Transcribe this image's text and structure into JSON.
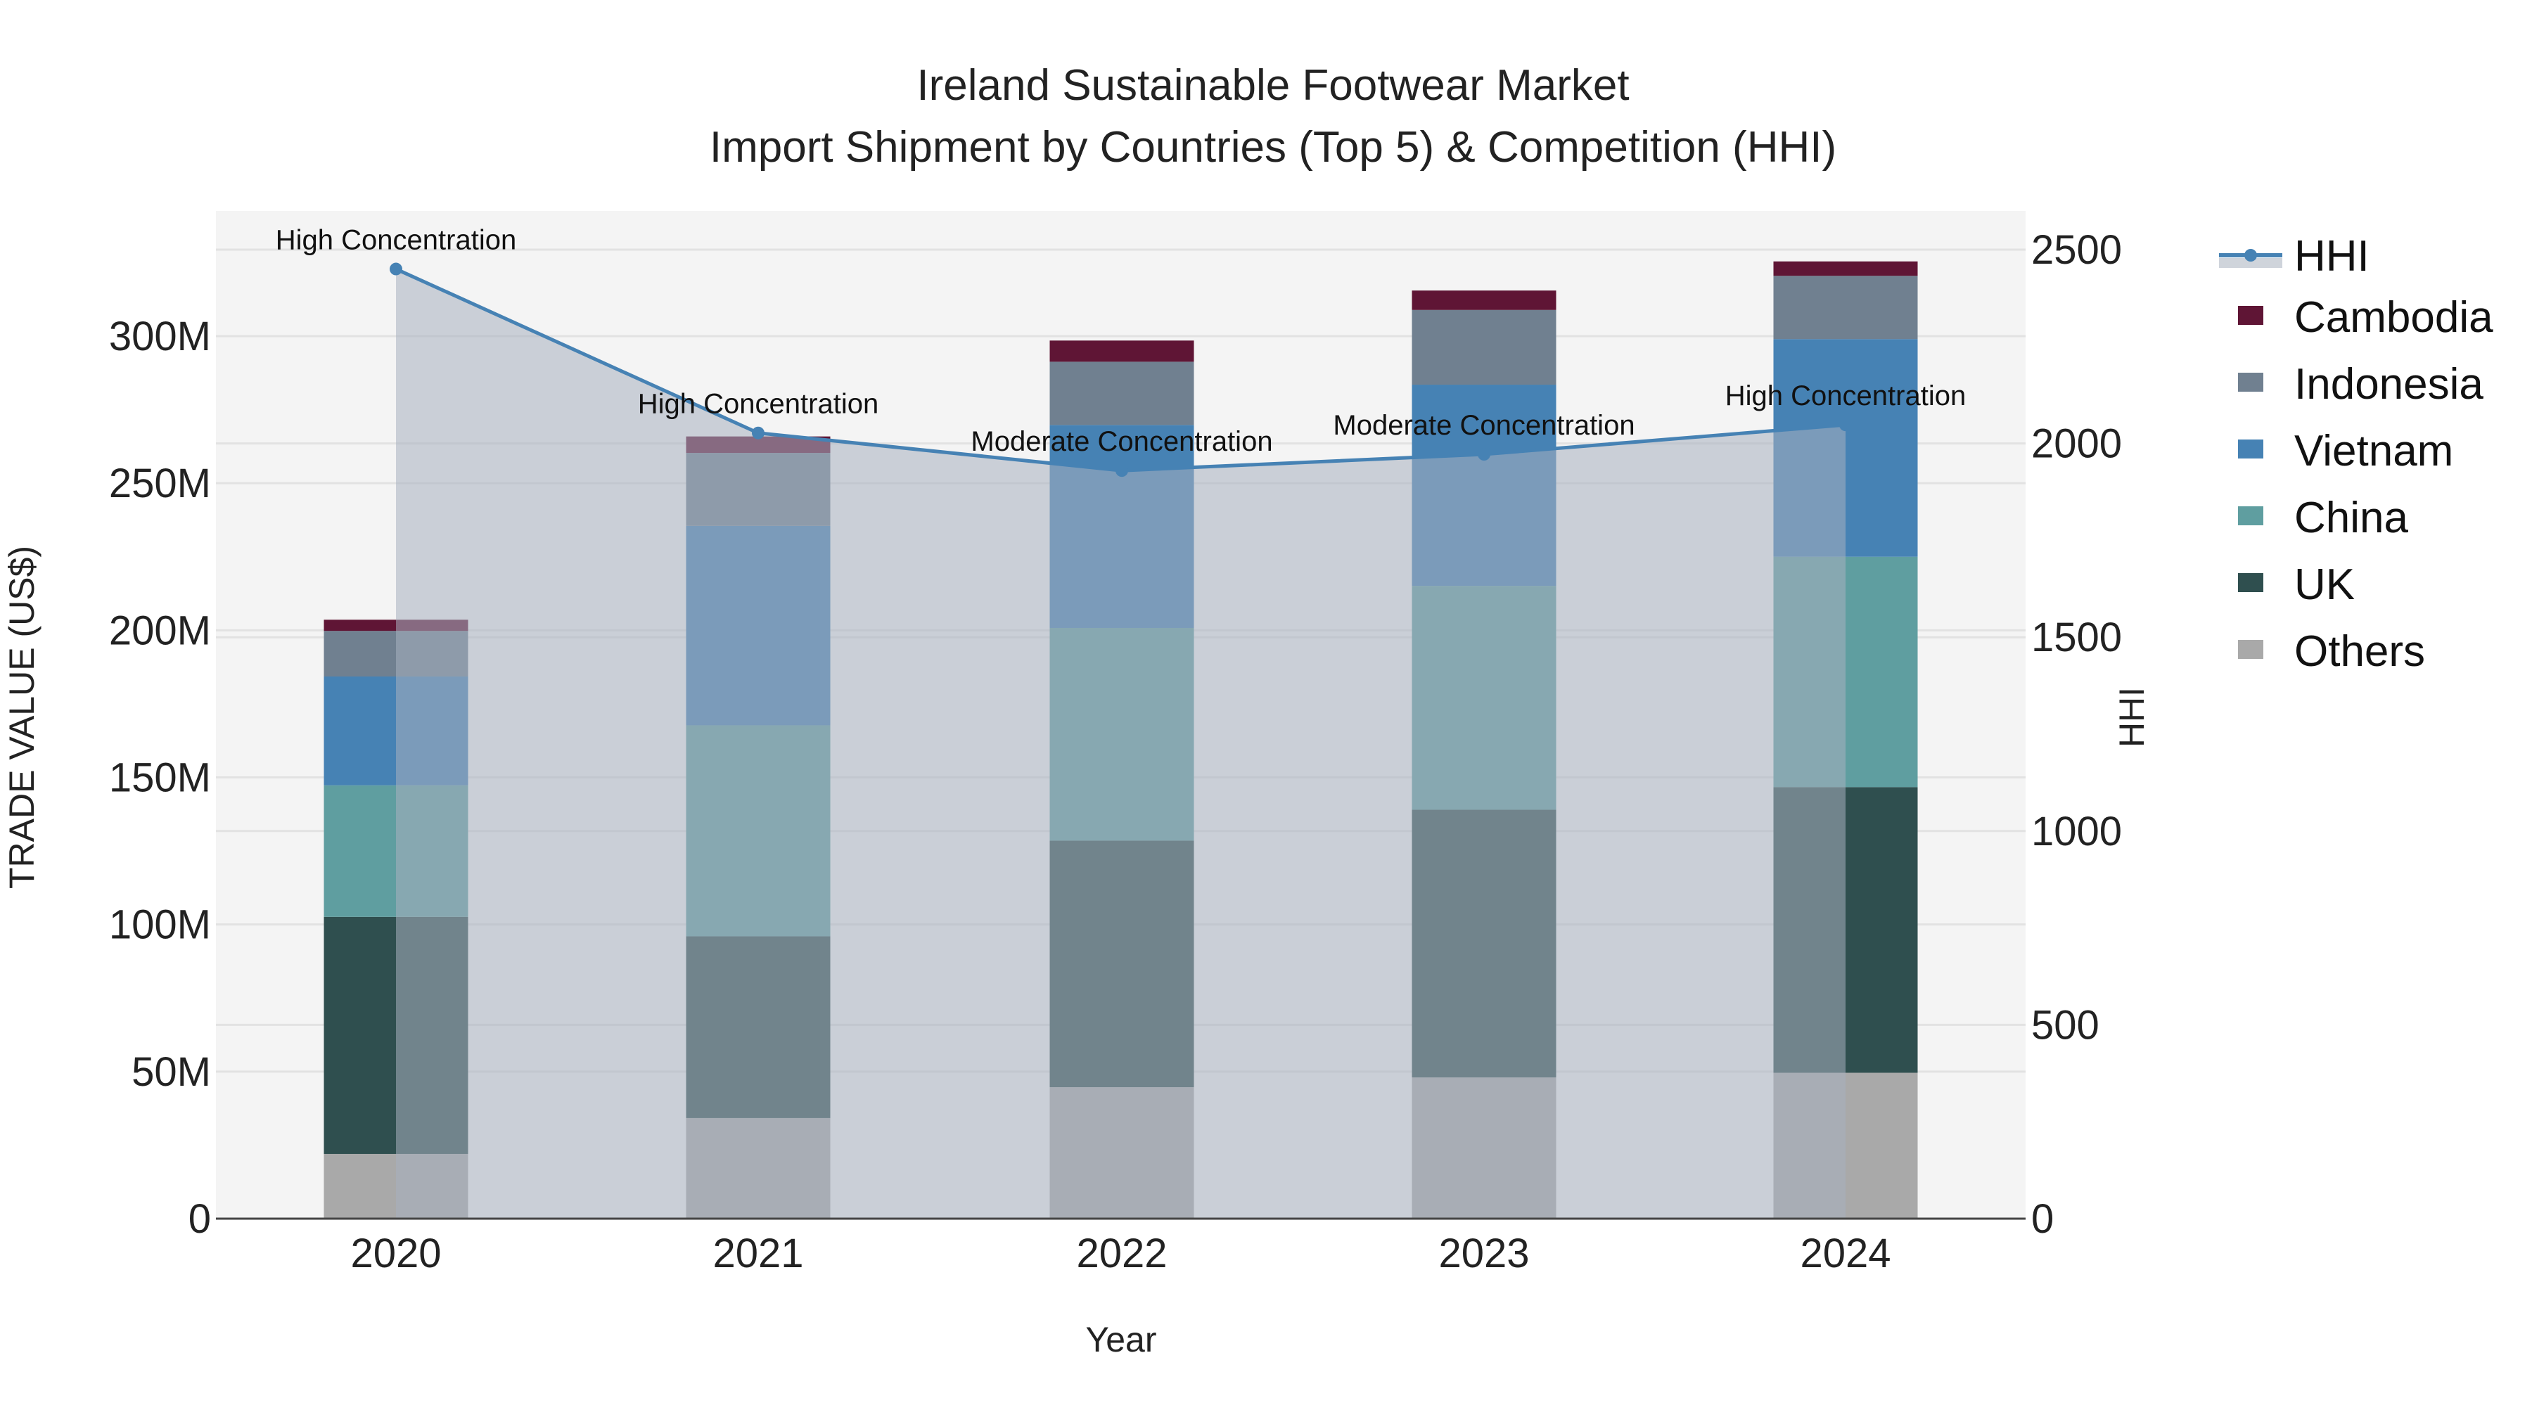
{
  "chart_data": {
    "type": "bar",
    "title_line1": "Ireland Sustainable Footwear Market",
    "title_line2": "Import Shipment by Countries (Top 5) & Competition (HHI)",
    "xlabel": "Year",
    "ylabel": "TRADE VALUE (US$)",
    "y2label": "HHI",
    "categories": [
      "2020",
      "2021",
      "2022",
      "2023",
      "2024"
    ],
    "ylim": [
      0,
      340
    ],
    "y_unit": "M",
    "y_ticks": [
      0,
      50,
      100,
      150,
      200,
      250,
      300
    ],
    "y_tick_labels": [
      "0",
      "50M",
      "100M",
      "150M",
      "200M",
      "250M",
      "300M"
    ],
    "y2lim": [
      0,
      2600
    ],
    "y2_ticks": [
      0,
      500,
      1000,
      1500,
      2000,
      2500
    ],
    "y2_tick_labels": [
      "0",
      "500",
      "1000",
      "1500",
      "2000",
      "2500"
    ],
    "series": [
      {
        "name": "Others",
        "color": "#a9a9a9",
        "values": [
          22.0,
          34.2,
          44.7,
          48.0,
          49.6
        ]
      },
      {
        "name": "UK",
        "color": "#2f4f4f",
        "values": [
          80.6,
          61.8,
          83.8,
          91.0,
          97.1
        ]
      },
      {
        "name": "China",
        "color": "#5f9ea0",
        "values": [
          44.7,
          71.7,
          72.3,
          76.1,
          78.3
        ]
      },
      {
        "name": "Vietnam",
        "color": "#4682b4",
        "values": [
          37.0,
          67.8,
          69.0,
          68.4,
          74.0
        ]
      },
      {
        "name": "Indonesia",
        "color": "#708090",
        "values": [
          15.5,
          24.8,
          21.5,
          25.4,
          21.5
        ]
      },
      {
        "name": "Cambodia",
        "color": "#5f1535",
        "values": [
          3.8,
          5.6,
          7.2,
          6.6,
          4.9
        ]
      }
    ],
    "hhi": {
      "name": "HHI",
      "color": "#4682b4",
      "values": [
        2450,
        2027,
        1930,
        1972,
        2048
      ],
      "annotations": [
        "High Concentration",
        "High Concentration",
        "Moderate Concentration",
        "Moderate Concentration",
        "High Concentration"
      ]
    },
    "legend": [
      "HHI",
      "Cambodia",
      "Indonesia",
      "Vietnam",
      "China",
      "UK",
      "Others"
    ],
    "legend_placement": "right",
    "grid": true
  }
}
